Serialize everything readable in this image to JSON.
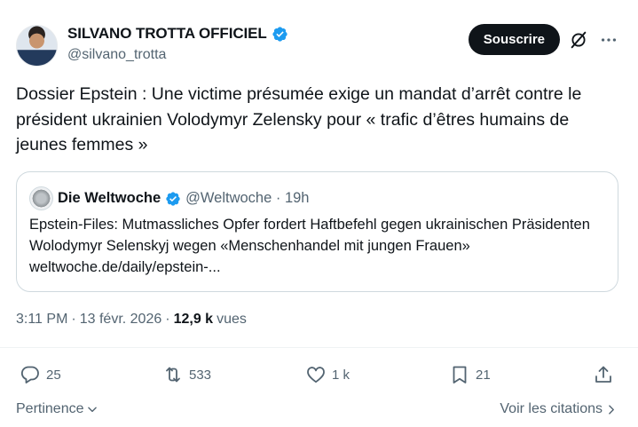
{
  "author": {
    "name": "SILVANO TROTTA OFFICIEL",
    "handle": "@silvano_trotta",
    "verified_color": "#1d9bf0"
  },
  "header": {
    "subscribe_label": "Souscrire",
    "grok_icon": "grok-icon",
    "more_icon": "more-icon"
  },
  "tweet": {
    "text": "Dossier Epstein : Une victime présumée exige un mandat d’arrêt contre le président ukrainien Volodymyr Zelensky pour « trafic d’êtres humains de jeunes femmes »"
  },
  "quote": {
    "name": "Die Weltwoche",
    "handle": "@Weltwoche · 19h",
    "text": "Epstein-Files: Mutmassliches Opfer fordert Haftbefehl gegen ukrainischen Präsidenten Wolodymyr Selenskyj wegen «Menschenhandel mit jungen Frauen» weltwoche.de/daily/epstein-..."
  },
  "meta": {
    "time": "3:11 PM",
    "separator1": "·",
    "date": "13 févr. 2026",
    "separator2": "·",
    "views_count": "12,9 k",
    "views_label": "vues"
  },
  "actions": {
    "replies": "25",
    "reposts": "533",
    "likes": "1 k",
    "bookmarks": "21"
  },
  "footer": {
    "sort_label": "Pertinence",
    "quotes_label": "Voir les citations"
  }
}
